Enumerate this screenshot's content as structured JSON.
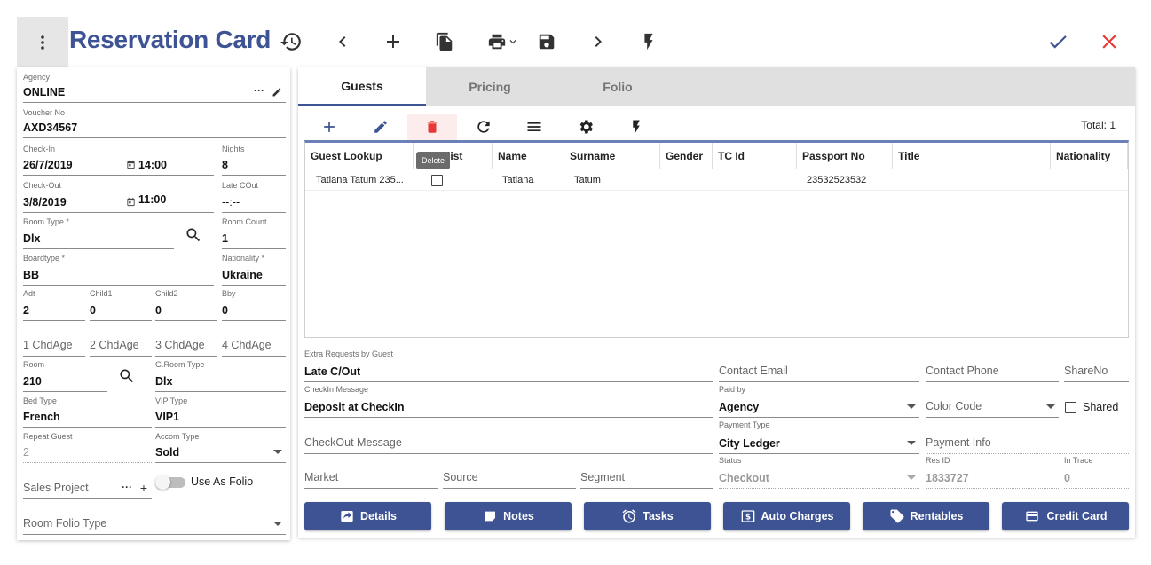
{
  "header": {
    "title": "Reservation Card",
    "icons": [
      "more-vert-icon",
      "history-icon",
      "chevron-left-icon",
      "add-icon",
      "copy-icon",
      "print-icon",
      "save-icon",
      "chevron-right-icon",
      "flash-icon",
      "check-icon",
      "close-icon"
    ]
  },
  "left": {
    "agency": {
      "label": "Agency",
      "value": "ONLINE"
    },
    "voucher": {
      "label": "Voucher No",
      "value": "AXD34567"
    },
    "checkin": {
      "label": "Check-In",
      "date": "26/7/2019",
      "time": "14:00"
    },
    "nights": {
      "label": "Nights",
      "value": "8"
    },
    "checkout": {
      "label": "Check-Out",
      "date": "3/8/2019",
      "time": "11:00"
    },
    "late_cout": {
      "label": "Late COut",
      "value": "--:--"
    },
    "room_type": {
      "label": "Room Type *",
      "value": "Dlx"
    },
    "room_count": {
      "label": "Room Count",
      "value": "1"
    },
    "boardtype": {
      "label": "Boardtype *",
      "value": "BB"
    },
    "nationality": {
      "label": "Nationality *",
      "value": "Ukraine"
    },
    "adt": {
      "label": "Adt",
      "value": "2"
    },
    "child1": {
      "label": "Child1",
      "value": "0"
    },
    "child2": {
      "label": "Child2",
      "value": "0"
    },
    "bby": {
      "label": "Bby",
      "value": "0"
    },
    "chd_ages": [
      "1 ChdAge",
      "2 ChdAge",
      "3 ChdAge",
      "4 ChdAge"
    ],
    "room": {
      "label": "Room",
      "value": "210"
    },
    "g_room_type": {
      "label": "G.Room Type",
      "value": "Dlx"
    },
    "bed_type": {
      "label": "Bed Type",
      "value": "French"
    },
    "vip_type": {
      "label": "VIP Type",
      "value": "VIP1"
    },
    "repeat_guest": {
      "label": "Repeat Guest",
      "value": "2"
    },
    "accom_type": {
      "label": "Accom Type",
      "value": "Sold"
    },
    "sales_project": {
      "placeholder": "Sales Project"
    },
    "use_as_folio": {
      "label": "Use As Folio",
      "on": false
    },
    "room_folio_type": {
      "placeholder": "Room Folio Type"
    }
  },
  "tabs": [
    {
      "label": "Guests",
      "active": true
    },
    {
      "label": "Pricing",
      "active": false
    },
    {
      "label": "Folio",
      "active": false
    }
  ],
  "grid": {
    "total": "Total: 1",
    "tooltip": "Delete",
    "columns": [
      "Guest Lookup",
      "Blacklist",
      "Name",
      "Surname",
      "Gender",
      "TC Id",
      "Passport No",
      "Title",
      "Nationality"
    ],
    "rows": [
      {
        "guest_lookup": "Tatiana Tatum 235...",
        "blacklist": false,
        "name": "Tatiana",
        "surname": "Tatum",
        "gender": "",
        "tc_id": "",
        "passport_no": "23532523532",
        "title": "",
        "nationality": ""
      }
    ]
  },
  "form": {
    "extra_requests": {
      "label": "Extra Requests by Guest",
      "value": "Late C/Out"
    },
    "contact_email": {
      "placeholder": "Contact Email"
    },
    "contact_phone": {
      "placeholder": "Contact Phone"
    },
    "share_no": {
      "placeholder": "ShareNo"
    },
    "checkin_message": {
      "label": "CheckIn Message",
      "value": "Deposit at CheckIn"
    },
    "paid_by": {
      "label": "Paid by",
      "value": "Agency"
    },
    "color_code": {
      "placeholder": "Color Code"
    },
    "shared": {
      "label": "Shared",
      "checked": false
    },
    "checkout_message": {
      "placeholder": "CheckOut Message"
    },
    "payment_type": {
      "label": "Payment Type",
      "value": "City Ledger"
    },
    "payment_info": {
      "placeholder": "Payment Info"
    },
    "market": {
      "placeholder": "Market"
    },
    "source": {
      "placeholder": "Source"
    },
    "segment": {
      "placeholder": "Segment"
    },
    "status": {
      "label": "Status",
      "value": "Checkout"
    },
    "res_id": {
      "label": "Res ID",
      "value": "1833727"
    },
    "in_trace": {
      "label": "In Trace",
      "value": "0"
    }
  },
  "buttons": [
    {
      "label": "Details",
      "icon": "share-icon"
    },
    {
      "label": "Notes",
      "icon": "note-icon"
    },
    {
      "label": "Tasks",
      "icon": "alarm-icon"
    },
    {
      "label": "Auto Charges",
      "icon": "dollar-icon"
    },
    {
      "label": "Rentables",
      "icon": "tag-icon"
    },
    {
      "label": "Credit Card",
      "icon": "credit-card-icon"
    }
  ],
  "colors": {
    "primary": "#3d5393",
    "danger": "#e53935",
    "tab_bg": "#e0e0e0"
  }
}
